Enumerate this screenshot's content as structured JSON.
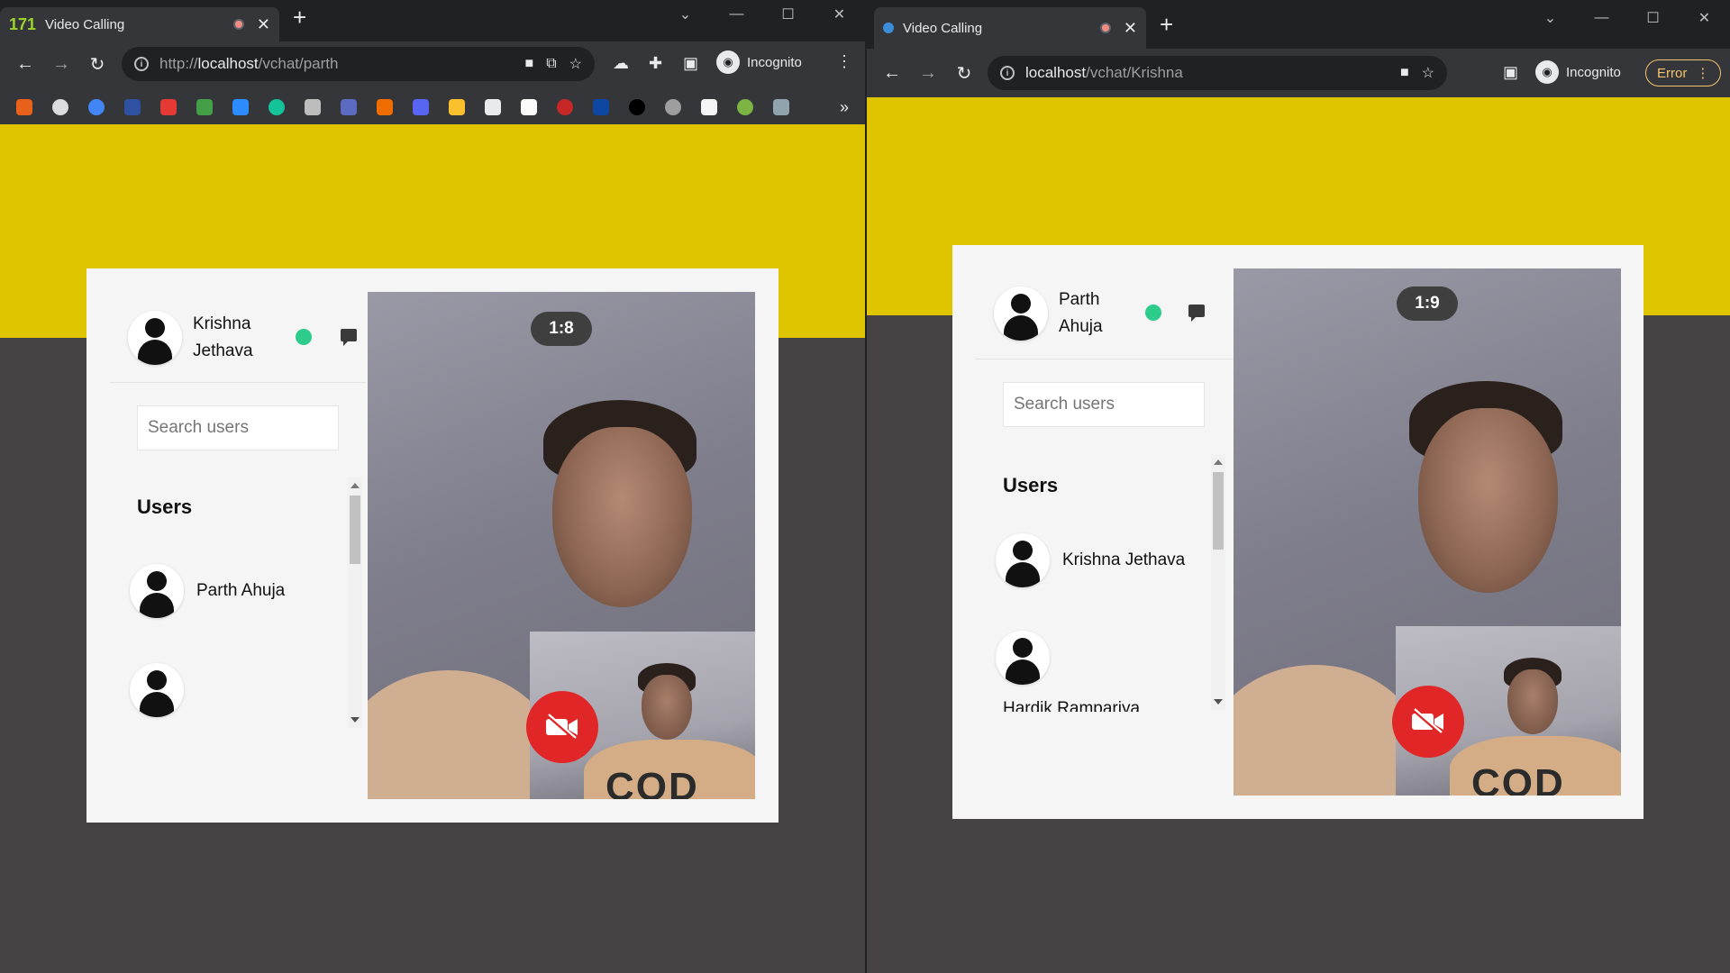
{
  "left_window": {
    "tab": {
      "favicon_text": "171",
      "title": "Video Calling"
    },
    "url": {
      "prefix": "http://",
      "host": "localhost",
      "path": "/vchat/parth"
    },
    "incognito_label": "Incognito",
    "more_bookmarks": "»",
    "profile": {
      "name_line1": "Krishna",
      "name_line2": "Jethava"
    },
    "search": {
      "placeholder": "Search users"
    },
    "users_heading": "Users",
    "users": [
      {
        "name": "Parth Ahuja"
      },
      {
        "name": ""
      }
    ],
    "timer": "1:8"
  },
  "right_window": {
    "tab": {
      "title": "Video Calling"
    },
    "url": {
      "host": "localhost",
      "path": "/vchat/Krishna"
    },
    "incognito_label": "Incognito",
    "error_label": "Error",
    "profile": {
      "name_line1": "Parth",
      "name_line2": "Ahuja"
    },
    "search": {
      "placeholder": "Search users"
    },
    "users_heading": "Users",
    "users": [
      {
        "name": "Krishna Jethava"
      },
      {
        "name": "Hardik Rampariya"
      }
    ],
    "timer": "1:9"
  },
  "colors": {
    "yellow_band": "#dec500",
    "background": "#474243",
    "online": "#2ecc8a",
    "end_call": "#e02626"
  },
  "icons": {
    "end_call": "video-off-icon",
    "chat": "chat-bubble-icon",
    "back": "arrow-left-icon",
    "forward": "arrow-right-icon",
    "reload": "reload-icon"
  }
}
